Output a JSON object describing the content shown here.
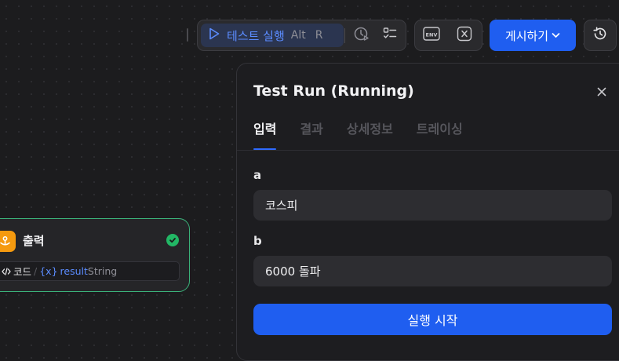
{
  "toolbar": {
    "run_label": "테스트 실행",
    "shortcut_key1": "Alt",
    "shortcut_key2": "R",
    "publish_label": "게시하기"
  },
  "panel": {
    "title": "Test Run (Running)",
    "tabs": [
      {
        "label": "입력",
        "active": true
      },
      {
        "label": "결과",
        "active": false
      },
      {
        "label": "상세정보",
        "active": false
      },
      {
        "label": "트레이싱",
        "active": false
      }
    ],
    "fields": [
      {
        "label": "a",
        "value": "코스피"
      },
      {
        "label": "b",
        "value": "6000 돌파"
      }
    ],
    "start_label": "실행 시작"
  },
  "node": {
    "title": "출력",
    "status": "success",
    "variable": {
      "source": "코드",
      "separator": "/",
      "var_symbol": "{x}",
      "name": "result",
      "type": "String"
    }
  },
  "colors": {
    "accent": "#1f5ef0",
    "success": "#22b765",
    "node_icon": "#f59a0f"
  }
}
